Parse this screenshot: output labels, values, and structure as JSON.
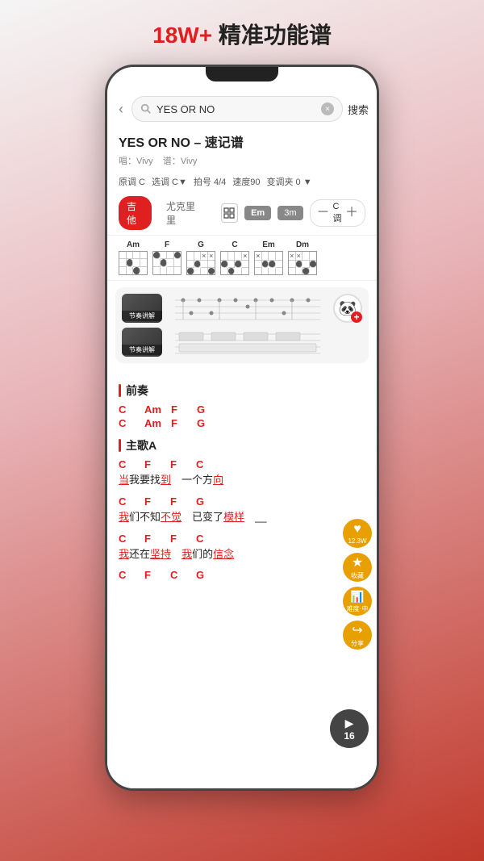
{
  "header": {
    "title_red": "18W+",
    "title_black": " 精准功能谱"
  },
  "search": {
    "back_label": "‹",
    "placeholder": "YES OR NO",
    "clear_label": "×",
    "search_btn": "搜索"
  },
  "song": {
    "title": "YES OR NO – 速记谱",
    "singer": "唱：Vivy",
    "composer": "谱：Vivy",
    "original_key": "原调 C",
    "selected_key": "选调 C▼",
    "time_sig": "拍号 4/4",
    "tempo": "速度90",
    "capo": "变调夹 0 ▼"
  },
  "instruments": {
    "guitar": "吉他",
    "ukulele": "尤克里里"
  },
  "badges": {
    "em": "Em",
    "three_m": "3m",
    "key_minus": "－",
    "key_label": "C调",
    "key_plus": "＋"
  },
  "chords": [
    {
      "name": "Am"
    },
    {
      "name": "F"
    },
    {
      "name": "G"
    },
    {
      "name": "C"
    },
    {
      "name": "Em"
    },
    {
      "name": "Dm"
    }
  ],
  "rhythm": {
    "items": [
      {
        "label": "节奏讲解"
      },
      {
        "label": "节奏讲解"
      }
    ],
    "panda_emoji": "🐼",
    "plus_label": "+"
  },
  "float_buttons": {
    "heart": "♥",
    "count": "12.3W",
    "star": "★",
    "star_label": "收藏",
    "chart": "📊",
    "chart_label": "难度·中",
    "share": "↪",
    "share_label": "分享"
  },
  "sections": [
    {
      "name": "前奏",
      "lines": [
        {
          "chords": [
            "C",
            "Am",
            "F",
            "G"
          ]
        },
        {
          "chords": [
            "C",
            "Am",
            "F",
            "G"
          ]
        }
      ]
    },
    {
      "name": "主歌A",
      "lyrics": [
        {
          "chords": [
            "C",
            "",
            "F",
            "F",
            "C"
          ],
          "lyric": "当我要找到　一个方向",
          "lyric_underline": [
            "当",
            "到",
            "向"
          ],
          "lyric_red": [
            "当"
          ]
        },
        {
          "chords": [
            "C",
            "",
            "F",
            "",
            "F",
            "G"
          ],
          "lyric": "我们不知不觉　已变了模样　__",
          "lyric_underline": [
            "我",
            "不觉",
            "模样"
          ],
          "lyric_red": [
            "我"
          ]
        },
        {
          "chords": [
            "C",
            "",
            "F",
            "F",
            "C"
          ],
          "lyric": "我还在坚持　我们的信念",
          "lyric_underline": [
            "我",
            "坚持",
            "信念"
          ],
          "lyric_red": [
            "我"
          ]
        },
        {
          "chords": [
            "C",
            "",
            "F",
            "",
            "C",
            "G"
          ],
          "lyric": "",
          "lyric_underline": []
        }
      ]
    }
  ],
  "play_btn": {
    "icon": "▶",
    "count": "16"
  }
}
